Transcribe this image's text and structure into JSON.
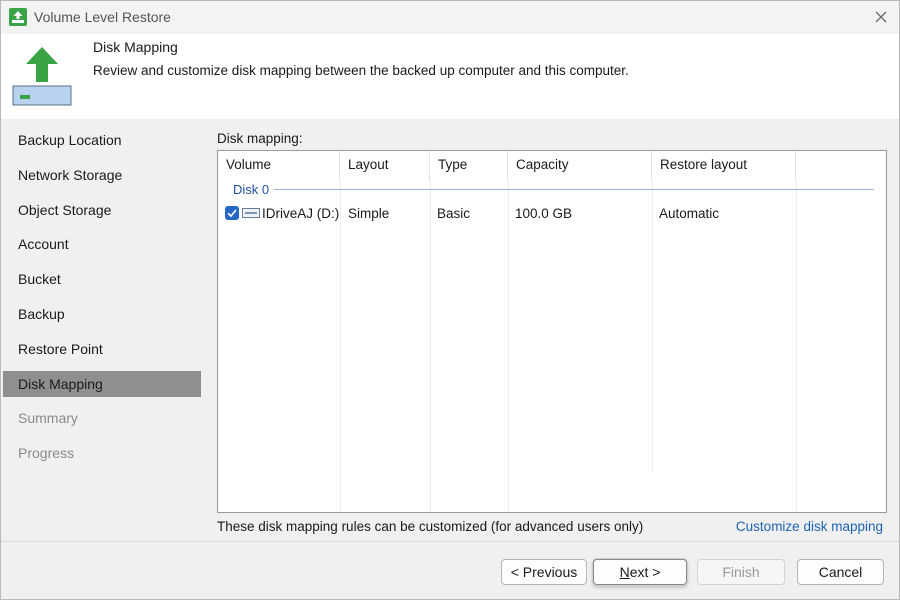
{
  "window": {
    "title": "Volume Level Restore"
  },
  "header": {
    "title": "Disk Mapping",
    "description": "Review and customize disk mapping between the backed up computer and this computer."
  },
  "sidebar": {
    "items": [
      {
        "label": "Backup Location",
        "state": "normal"
      },
      {
        "label": "Network Storage",
        "state": "normal"
      },
      {
        "label": "Object Storage",
        "state": "normal"
      },
      {
        "label": "Account",
        "state": "normal"
      },
      {
        "label": "Bucket",
        "state": "normal"
      },
      {
        "label": "Backup",
        "state": "normal"
      },
      {
        "label": "Restore Point",
        "state": "normal"
      },
      {
        "label": "Disk Mapping",
        "state": "active"
      },
      {
        "label": "Summary",
        "state": "disabled"
      },
      {
        "label": "Progress",
        "state": "disabled"
      }
    ]
  },
  "main": {
    "section_label": "Disk mapping:",
    "columns": [
      "Volume",
      "Layout",
      "Type",
      "Capacity",
      "Restore layout"
    ],
    "group_label": "Disk 0",
    "rows": [
      {
        "checked": true,
        "volume": "IDriveAJ (D:)",
        "layout": "Simple",
        "type": "Basic",
        "capacity": "100.0 GB",
        "restore_layout": "Automatic"
      }
    ],
    "footer_note": "These disk mapping rules can be customized (for advanced users only)",
    "customize_link": "Customize disk mapping"
  },
  "buttons": {
    "previous": "< Previous",
    "next_accel": "N",
    "next_rest": "ext >",
    "finish": "Finish",
    "cancel": "Cancel"
  },
  "colors": {
    "accent": "#2568c8",
    "link": "#1c64b5",
    "icon_green": "#3aa345",
    "sidebar_active": "#8f8f8f"
  },
  "icons": {
    "app": "restore-upload-icon",
    "header": "restore-arrow-disk-icon",
    "close": "close-icon",
    "volume": "drive-icon"
  }
}
